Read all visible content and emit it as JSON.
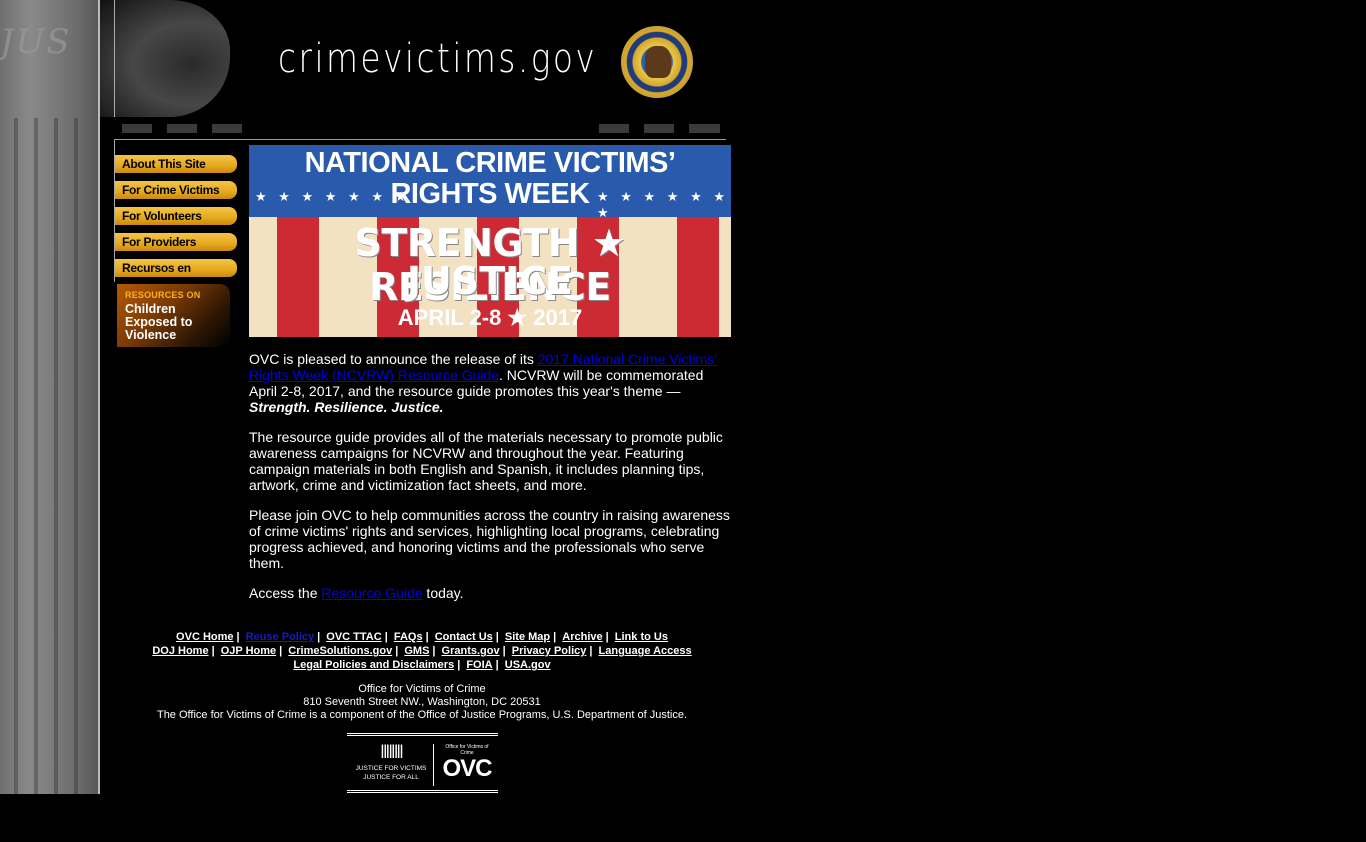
{
  "header": {
    "pillar_text": "JUS",
    "site_title": "crimevictims.gov",
    "seal_name": "Department of Justice Office of Justice Programs seal"
  },
  "nav": {
    "items": [
      {
        "label": "About This Site"
      },
      {
        "label": "For Crime Victims"
      },
      {
        "label": "For Volunteers"
      },
      {
        "label": "For Providers"
      },
      {
        "label": "Recursos en Español"
      }
    ],
    "resources": {
      "top": "RESOURCES ON",
      "bottom": "Children Exposed to Violence"
    }
  },
  "banner": {
    "line1": "NATIONAL CRIME VICTIMS’",
    "line2": "RIGHTS WEEK",
    "line3": "STRENGTH ★ RESILIENCE",
    "line4": "JUSTICE",
    "line5": "APRIL 2-8 ★ 2017",
    "stars": "★ ★ ★ ★ ★ ★ ★"
  },
  "article": {
    "p1_a": "OVC is pleased to announce the release of its ",
    "p1_link": "2017 National Crime Victims' Rights Week (NCVRW) Resource Guide",
    "p1_b": ". NCVRW will be commemorated April 2-8, 2017, and the resource guide promotes this year's theme —",
    "p1_theme": "Strength. Resilience. Justice.",
    "p2": "The resource guide provides all of the materials necessary to promote public awareness campaigns for NCVRW and throughout the year. Featuring campaign materials in both English and Spanish, it includes planning tips, artwork, crime and victimization fact sheets, and more.",
    "p3": "Please join OVC to help communities across the country in raising awareness of crime victims' rights and services, highlighting local programs, celebrating progress achieved, and honoring victims and the professionals who serve them.",
    "p4_a": "Access the ",
    "p4_link": "Resource Guide",
    "p4_b": " today."
  },
  "footer": {
    "row1": [
      "OVC Home",
      "Reuse Policy",
      "OVC TTAC",
      "FAQs",
      "Contact Us",
      "Site Map",
      "Archive",
      "Link to Us"
    ],
    "row2": [
      "DOJ Home",
      "OJP Home",
      "CrimeSolutions.gov",
      "GMS",
      "Grants.gov",
      "Privacy Policy",
      "Language Access"
    ],
    "row3": [
      "Legal Policies and Disclaimers",
      "FOIA",
      "USA.gov"
    ],
    "separator": "|"
  },
  "address": {
    "org": "Office for Victims of Crime",
    "street": "810 Seventh Street NW., Washington, DC 20531",
    "note": "The Office for Victims of Crime is a component of the Office of Justice Programs, U.S. Department of Justice."
  },
  "ovc_logo": {
    "tagline1": "JUSTICE FOR VICTIMS",
    "tagline2": "JUSTICE FOR ALL",
    "small": "Office for Victims of Crime",
    "big": "OVC",
    "pillars": "ǁǁǁǁ"
  },
  "colors": {
    "background": "#000000",
    "nav_button": "#e6a91c",
    "link": "#0000ee",
    "visited_link": "#1a1ab8",
    "banner_blue": "#2a5aab",
    "banner_red": "#cc2a35"
  }
}
